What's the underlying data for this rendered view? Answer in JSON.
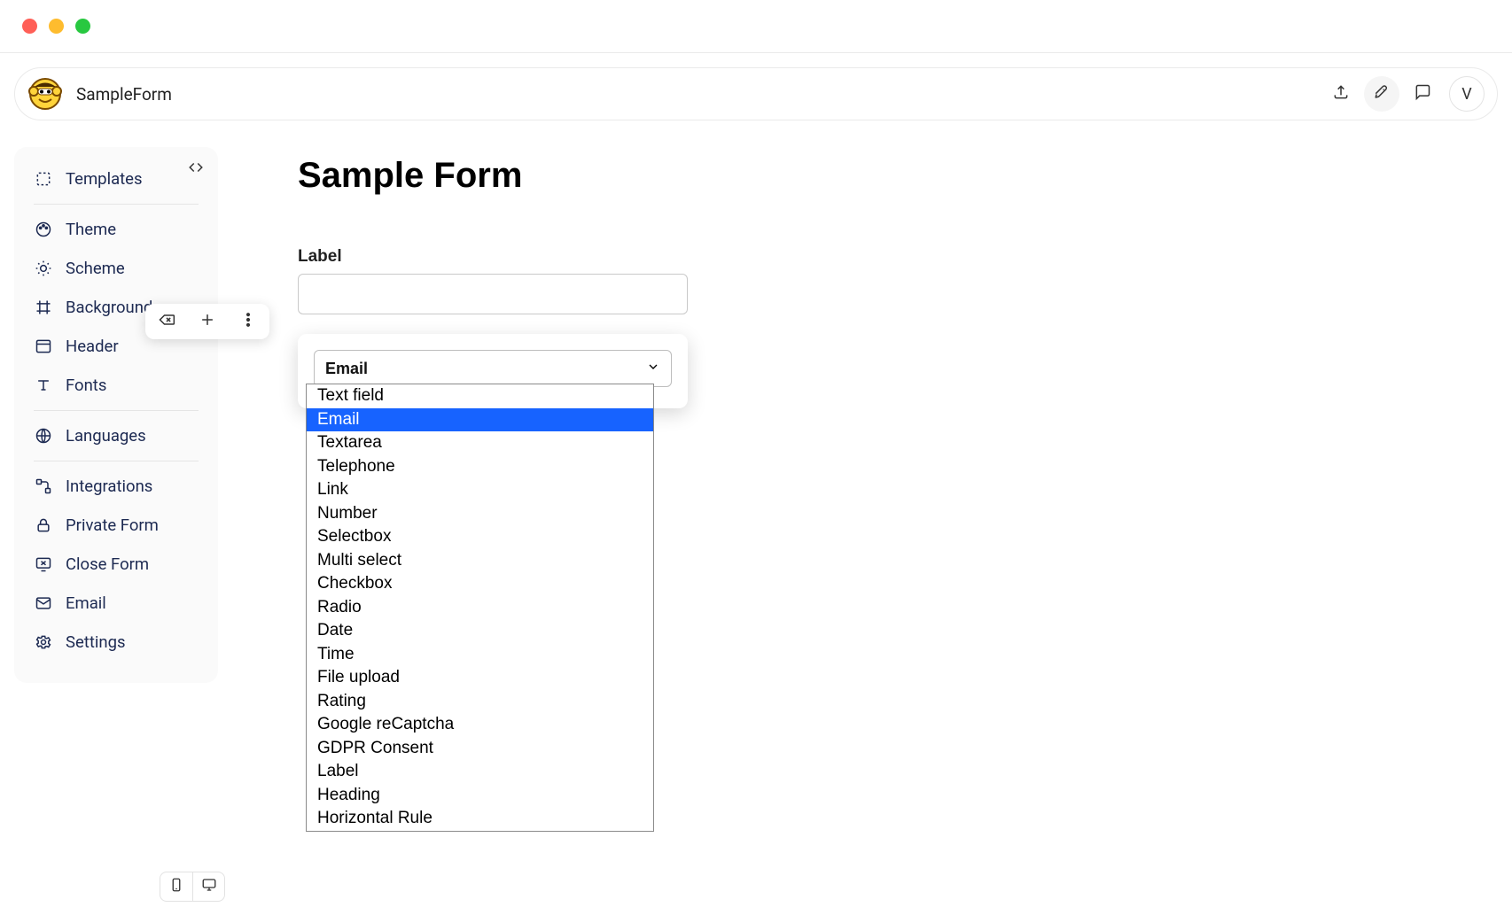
{
  "header": {
    "form_name": "SampleForm",
    "avatar_initial": "V"
  },
  "sidebar": {
    "items": [
      {
        "label": "Templates"
      },
      {
        "label": "Theme"
      },
      {
        "label": "Scheme"
      },
      {
        "label": "Background"
      },
      {
        "label": "Header"
      },
      {
        "label": "Fonts"
      },
      {
        "label": "Languages"
      },
      {
        "label": "Integrations"
      },
      {
        "label": "Private Form"
      },
      {
        "label": "Close Form"
      },
      {
        "label": "Email"
      },
      {
        "label": "Settings"
      }
    ]
  },
  "form": {
    "title": "Sample Form",
    "field_label": "Label",
    "field_value": ""
  },
  "field_type_select": {
    "selected": "Email",
    "options": [
      "Text field",
      "Email",
      "Textarea",
      "Telephone",
      "Link",
      "Number",
      "Selectbox",
      "Multi select",
      "Checkbox",
      "Radio",
      "Date",
      "Time",
      "File upload",
      "Rating",
      "Google reCaptcha",
      "GDPR Consent",
      "Label",
      "Heading",
      "Horizontal Rule"
    ]
  }
}
